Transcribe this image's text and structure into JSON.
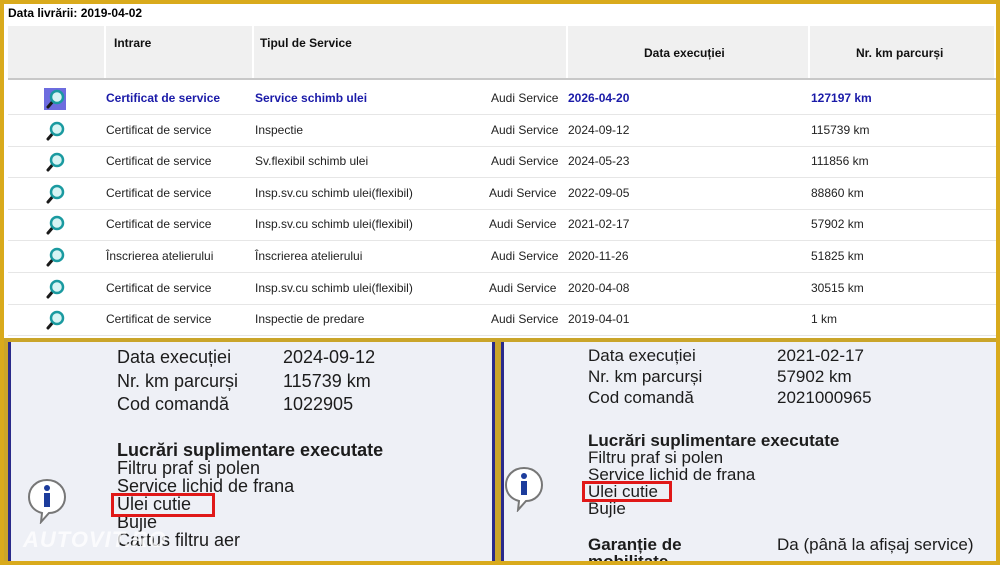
{
  "delivery": {
    "label": "Data livrării: 2019-04-02"
  },
  "table": {
    "columns": [
      "Intrare",
      "Tipul de Service",
      "Data execuției",
      "Nr. km parcurși"
    ],
    "rows": [
      {
        "entry": "Certificat de service",
        "type": "Service schimb ulei",
        "provider": "Audi Service",
        "date": "2026-04-20",
        "km": "127197 km",
        "selected": true
      },
      {
        "entry": "Certificat de service",
        "type": "Inspectie",
        "provider": "Audi Service",
        "date": "2024-09-12",
        "km": "115739 km"
      },
      {
        "entry": "Certificat de service",
        "type": "Sv.flexibil schimb ulei",
        "provider": "Audi Service",
        "date": "2024-05-23",
        "km": "111856 km"
      },
      {
        "entry": "Certificat de service",
        "type": "Insp.sv.cu schimb ulei(flexibil)",
        "provider": "Audi Service",
        "date": "2022-09-05",
        "km": "88860 km"
      },
      {
        "entry": "Certificat de service",
        "type": "Insp.sv.cu schimb ulei(flexibil)",
        "provider": "Audi Service",
        "date": "2021-02-17",
        "km": "57902 km"
      },
      {
        "entry": "Înscrierea atelierului",
        "type": "Înscrierea atelierului",
        "provider": "Audi Service",
        "date": "2020-11-26",
        "km": "51825 km"
      },
      {
        "entry": "Certificat de service",
        "type": "Insp.sv.cu schimb ulei(flexibil)",
        "provider": "Audi Service",
        "date": "2020-04-08",
        "km": "30515 km"
      },
      {
        "entry": "Certificat de service",
        "type": "Inspectie de predare",
        "provider": "Audi Service",
        "date": "2019-04-01",
        "km": "1 km"
      }
    ]
  },
  "left_panel": {
    "date_label": "Data execuției",
    "date_value": "2024-09-12",
    "km_label": "Nr. km parcurși",
    "km_value": "115739 km",
    "order_label": "Cod comandă",
    "order_value": "1022905",
    "extra_title": "Lucrări suplimentare executate",
    "extras": [
      "Filtru praf si polen",
      "Service lichid de frana",
      "Ulei cutie",
      "Bujie",
      "Cartus filtru aer"
    ]
  },
  "right_panel": {
    "date_label": "Data execuției",
    "date_value": "2021-02-17",
    "km_label": "Nr. km parcurși",
    "km_value": "57902 km",
    "order_label": "Cod comandă",
    "order_value": "2021000965",
    "extra_title": "Lucrări suplimentare executate",
    "extras": [
      "Filtru praf si polen",
      "Service lichid de frana",
      "Ulei cutie",
      "Bujie"
    ],
    "guarantee_label": "Garanție de mobilitate",
    "guarantee_value": "Da (până la afișaj service)"
  },
  "watermark": "AUTOVIT.RO",
  "colors": {
    "frame": "#d9aa1c",
    "highlight": "#e01818",
    "selected_text": "#1a1aa8"
  }
}
